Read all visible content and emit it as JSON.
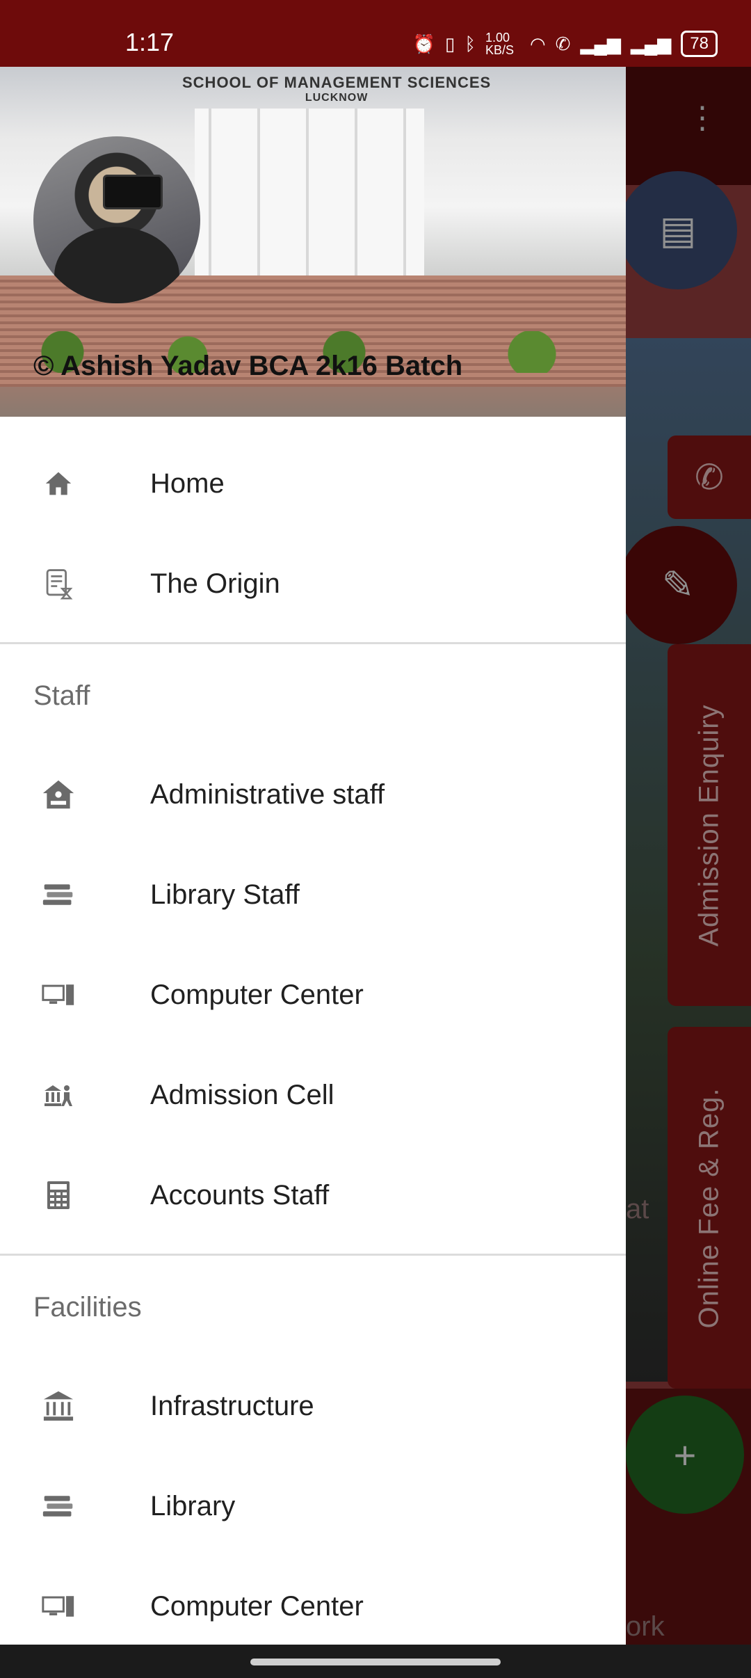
{
  "status_bar": {
    "time": "1:17",
    "net_speed": "1.00 KB/S",
    "battery": "78"
  },
  "background_app": {
    "side_tabs": [
      "Admission Enquiry",
      "Online Fee & Reg."
    ],
    "ghost_texts": [
      "at",
      "ork"
    ]
  },
  "drawer": {
    "header": {
      "building_title": "SCHOOL OF MANAGEMENT SCIENCES",
      "building_subtitle": "LUCKNOW",
      "copyright": "© Ashish Yadav BCA 2k16 Batch"
    },
    "main_items": [
      {
        "label": "Home",
        "icon": "home-icon"
      },
      {
        "label": "The Origin",
        "icon": "document-icon"
      }
    ],
    "staff_section": {
      "title": "Staff",
      "items": [
        {
          "label": "Administrative staff",
          "icon": "admin-building-icon"
        },
        {
          "label": "Library Staff",
          "icon": "books-icon"
        },
        {
          "label": "Computer Center",
          "icon": "desktop-icon"
        },
        {
          "label": "Admission Cell",
          "icon": "admission-icon"
        },
        {
          "label": "Accounts Staff",
          "icon": "calculator-icon"
        }
      ]
    },
    "facilities_section": {
      "title": "Facilities",
      "items": [
        {
          "label": "Infrastructure",
          "icon": "institution-icon"
        },
        {
          "label": "Library",
          "icon": "books-icon"
        },
        {
          "label": "Computer Center",
          "icon": "desktop-icon"
        }
      ]
    }
  }
}
